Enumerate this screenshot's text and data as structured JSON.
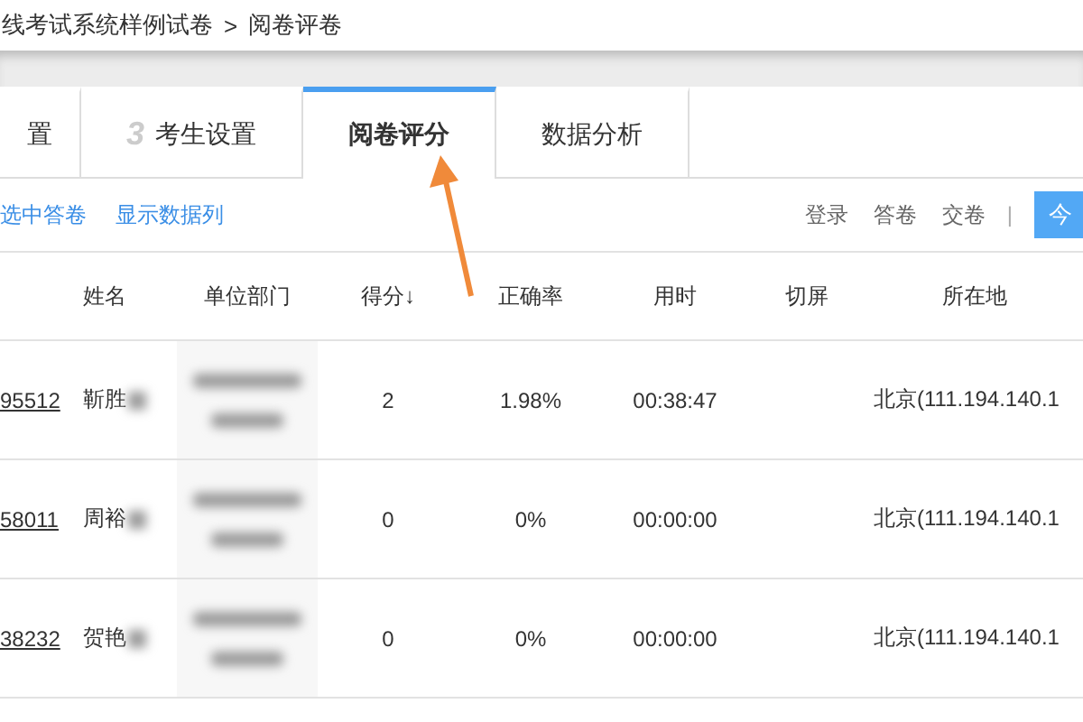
{
  "breadcrumb": {
    "path": "线考试系统样例试卷",
    "separator": ">",
    "current": "阅卷评卷"
  },
  "tabs": [
    {
      "label": "置",
      "selected": false
    },
    {
      "label": "考生设置",
      "step": "3",
      "selected": false
    },
    {
      "label": "阅卷评分",
      "selected": true
    },
    {
      "label": "数据分析",
      "selected": false
    }
  ],
  "toolbar": {
    "links": [
      "选中答卷",
      "显示数据列"
    ],
    "filters": [
      "登录",
      "答卷",
      "交卷"
    ],
    "separator": "|",
    "button": "今"
  },
  "table": {
    "columns": [
      "",
      "姓名",
      "单位部门",
      "得分↓",
      "正确率",
      "用时",
      "切屏",
      "所在地"
    ],
    "rows": [
      {
        "id": "95512",
        "name": "靳胜",
        "score": "2",
        "rate": "1.98%",
        "time": "00:38:47",
        "location": "北京(111.194.140.1"
      },
      {
        "id": "58011",
        "name": "周裕",
        "score": "0",
        "rate": "0%",
        "time": "00:00:00",
        "location": "北京(111.194.140.1"
      },
      {
        "id": "38232",
        "name": "贺艳",
        "score": "0",
        "rate": "0%",
        "time": "00:00:00",
        "location": "北京(111.194.140.1"
      }
    ]
  }
}
